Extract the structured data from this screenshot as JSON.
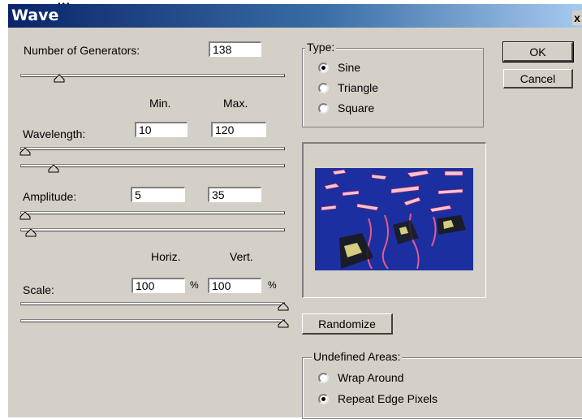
{
  "window": {
    "title": "Wave",
    "close_glyph": "x"
  },
  "generators": {
    "label": "Number of Generators:",
    "value": "138",
    "slider_fraction": 0.12
  },
  "range_headers": {
    "min": "Min.",
    "max": "Max."
  },
  "wavelength": {
    "label": "Wavelength:",
    "min": "10",
    "max": "120",
    "min_slider_fraction": 0.0,
    "max_slider_fraction": 0.12
  },
  "amplitude": {
    "label": "Amplitude:",
    "min": "5",
    "max": "35",
    "min_slider_fraction": 0.0,
    "max_slider_fraction": 0.04
  },
  "scale_headers": {
    "horiz": "Horiz.",
    "vert": "Vert."
  },
  "scale": {
    "label": "Scale:",
    "horiz": "100",
    "vert": "100",
    "unit": "%",
    "horiz_slider_fraction": 1.0,
    "vert_slider_fraction": 1.0
  },
  "type_group": {
    "legend": "Type:",
    "options": [
      {
        "label": "Sine",
        "selected": true
      },
      {
        "label": "Triangle",
        "selected": false
      },
      {
        "label": "Square",
        "selected": false
      }
    ]
  },
  "buttons": {
    "ok": "OK",
    "cancel": "Cancel",
    "randomize": "Randomize"
  },
  "undefined_group": {
    "legend": "Undefined Areas:",
    "options": [
      {
        "label": "Wrap Around",
        "selected": false
      },
      {
        "label": "Repeat Edge Pixels",
        "selected": true
      }
    ]
  },
  "colors": {
    "title_start": "#0a246a",
    "title_end": "#a6caf0",
    "face": "#d4d0c8",
    "preview_bg": "#1a2b9a"
  }
}
